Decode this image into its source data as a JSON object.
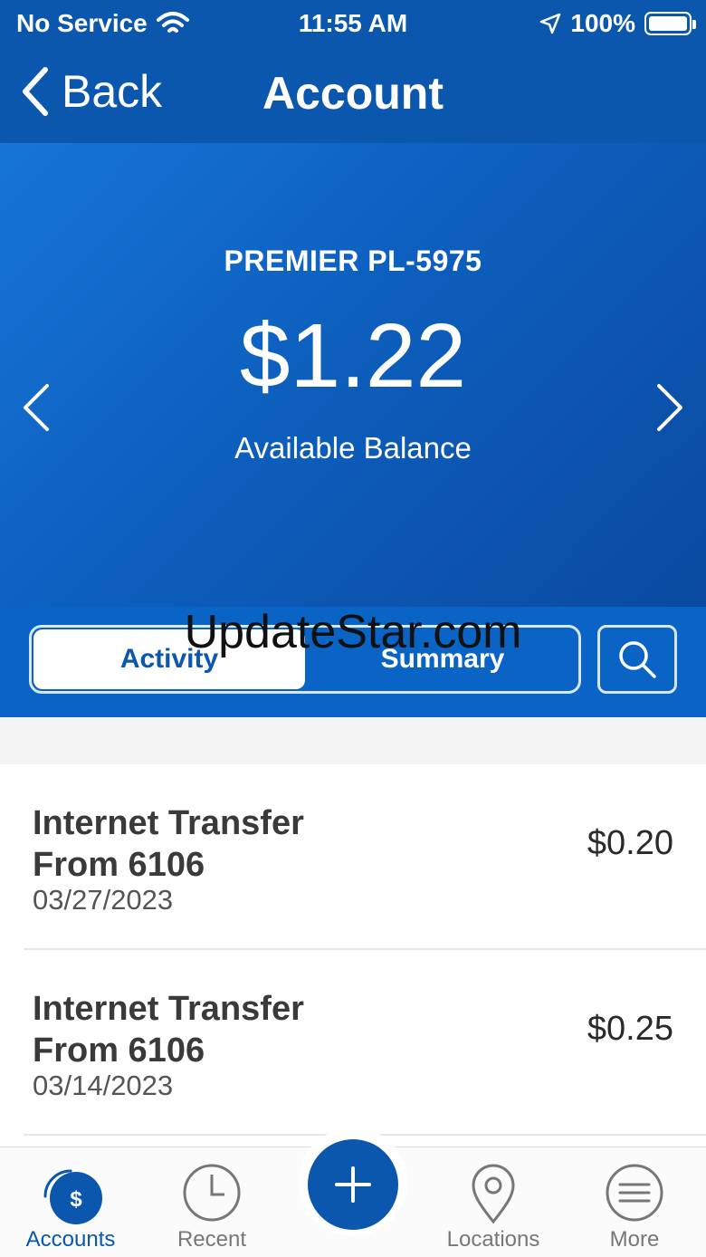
{
  "status_bar": {
    "carrier": "No Service",
    "time": "11:55 AM",
    "battery": "100%"
  },
  "nav": {
    "back_label": "Back",
    "title": "Account"
  },
  "account": {
    "name": "PREMIER PL-5975",
    "balance": "$1.22",
    "balance_label": "Available Balance"
  },
  "segments": {
    "activity": "Activity",
    "summary": "Summary"
  },
  "watermark": "UpdateStar.com",
  "transactions": [
    {
      "desc_line1": "Internet Transfer",
      "desc_line2": "From 6106",
      "date": "03/27/2023",
      "amount": "$0.20"
    },
    {
      "desc_line1": "Internet Transfer",
      "desc_line2": "From 6106",
      "date": "03/14/2023",
      "amount": "$0.25"
    }
  ],
  "tabs": {
    "accounts": "Accounts",
    "recent": "Recent",
    "locations": "Locations",
    "more": "More",
    "accounts_badge": "$"
  },
  "colors": {
    "brand": "#0a57ad",
    "hero": "#0d5fbe",
    "segment_bar": "#0a64c6"
  }
}
